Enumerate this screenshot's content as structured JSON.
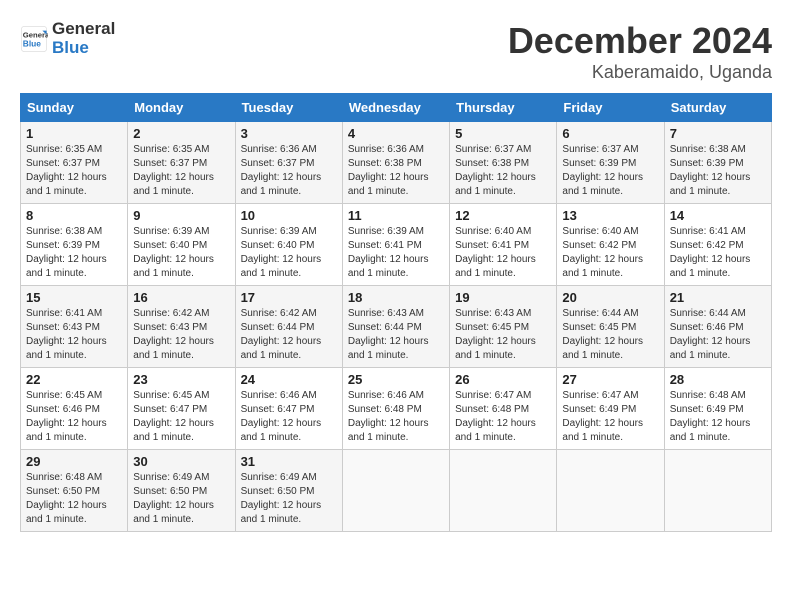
{
  "header": {
    "logo": {
      "general": "General",
      "blue": "Blue"
    },
    "title": "December 2024",
    "location": "Kaberamaido, Uganda"
  },
  "calendar": {
    "weekdays": [
      "Sunday",
      "Monday",
      "Tuesday",
      "Wednesday",
      "Thursday",
      "Friday",
      "Saturday"
    ],
    "weeks": [
      [
        {
          "day": 1,
          "sunrise": "6:35 AM",
          "sunset": "6:37 PM",
          "daylight": "12 hours and 1 minute."
        },
        {
          "day": 2,
          "sunrise": "6:35 AM",
          "sunset": "6:37 PM",
          "daylight": "12 hours and 1 minute."
        },
        {
          "day": 3,
          "sunrise": "6:36 AM",
          "sunset": "6:37 PM",
          "daylight": "12 hours and 1 minute."
        },
        {
          "day": 4,
          "sunrise": "6:36 AM",
          "sunset": "6:38 PM",
          "daylight": "12 hours and 1 minute."
        },
        {
          "day": 5,
          "sunrise": "6:37 AM",
          "sunset": "6:38 PM",
          "daylight": "12 hours and 1 minute."
        },
        {
          "day": 6,
          "sunrise": "6:37 AM",
          "sunset": "6:39 PM",
          "daylight": "12 hours and 1 minute."
        },
        {
          "day": 7,
          "sunrise": "6:38 AM",
          "sunset": "6:39 PM",
          "daylight": "12 hours and 1 minute."
        }
      ],
      [
        {
          "day": 8,
          "sunrise": "6:38 AM",
          "sunset": "6:39 PM",
          "daylight": "12 hours and 1 minute."
        },
        {
          "day": 9,
          "sunrise": "6:39 AM",
          "sunset": "6:40 PM",
          "daylight": "12 hours and 1 minute."
        },
        {
          "day": 10,
          "sunrise": "6:39 AM",
          "sunset": "6:40 PM",
          "daylight": "12 hours and 1 minute."
        },
        {
          "day": 11,
          "sunrise": "6:39 AM",
          "sunset": "6:41 PM",
          "daylight": "12 hours and 1 minute."
        },
        {
          "day": 12,
          "sunrise": "6:40 AM",
          "sunset": "6:41 PM",
          "daylight": "12 hours and 1 minute."
        },
        {
          "day": 13,
          "sunrise": "6:40 AM",
          "sunset": "6:42 PM",
          "daylight": "12 hours and 1 minute."
        },
        {
          "day": 14,
          "sunrise": "6:41 AM",
          "sunset": "6:42 PM",
          "daylight": "12 hours and 1 minute."
        }
      ],
      [
        {
          "day": 15,
          "sunrise": "6:41 AM",
          "sunset": "6:43 PM",
          "daylight": "12 hours and 1 minute."
        },
        {
          "day": 16,
          "sunrise": "6:42 AM",
          "sunset": "6:43 PM",
          "daylight": "12 hours and 1 minute."
        },
        {
          "day": 17,
          "sunrise": "6:42 AM",
          "sunset": "6:44 PM",
          "daylight": "12 hours and 1 minute."
        },
        {
          "day": 18,
          "sunrise": "6:43 AM",
          "sunset": "6:44 PM",
          "daylight": "12 hours and 1 minute."
        },
        {
          "day": 19,
          "sunrise": "6:43 AM",
          "sunset": "6:45 PM",
          "daylight": "12 hours and 1 minute."
        },
        {
          "day": 20,
          "sunrise": "6:44 AM",
          "sunset": "6:45 PM",
          "daylight": "12 hours and 1 minute."
        },
        {
          "day": 21,
          "sunrise": "6:44 AM",
          "sunset": "6:46 PM",
          "daylight": "12 hours and 1 minute."
        }
      ],
      [
        {
          "day": 22,
          "sunrise": "6:45 AM",
          "sunset": "6:46 PM",
          "daylight": "12 hours and 1 minute."
        },
        {
          "day": 23,
          "sunrise": "6:45 AM",
          "sunset": "6:47 PM",
          "daylight": "12 hours and 1 minute."
        },
        {
          "day": 24,
          "sunrise": "6:46 AM",
          "sunset": "6:47 PM",
          "daylight": "12 hours and 1 minute."
        },
        {
          "day": 25,
          "sunrise": "6:46 AM",
          "sunset": "6:48 PM",
          "daylight": "12 hours and 1 minute."
        },
        {
          "day": 26,
          "sunrise": "6:47 AM",
          "sunset": "6:48 PM",
          "daylight": "12 hours and 1 minute."
        },
        {
          "day": 27,
          "sunrise": "6:47 AM",
          "sunset": "6:49 PM",
          "daylight": "12 hours and 1 minute."
        },
        {
          "day": 28,
          "sunrise": "6:48 AM",
          "sunset": "6:49 PM",
          "daylight": "12 hours and 1 minute."
        }
      ],
      [
        {
          "day": 29,
          "sunrise": "6:48 AM",
          "sunset": "6:50 PM",
          "daylight": "12 hours and 1 minute."
        },
        {
          "day": 30,
          "sunrise": "6:49 AM",
          "sunset": "6:50 PM",
          "daylight": "12 hours and 1 minute."
        },
        {
          "day": 31,
          "sunrise": "6:49 AM",
          "sunset": "6:50 PM",
          "daylight": "12 hours and 1 minute."
        },
        null,
        null,
        null,
        null
      ]
    ],
    "labels": {
      "sunrise": "Sunrise:",
      "sunset": "Sunset:",
      "daylight": "Daylight:"
    }
  }
}
